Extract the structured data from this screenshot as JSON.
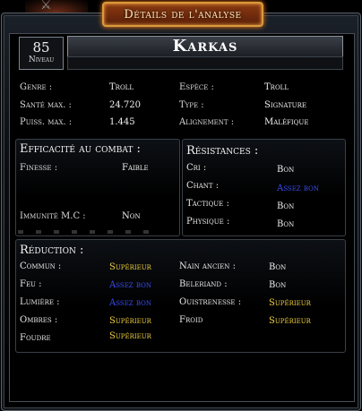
{
  "window": {
    "title": "Détails de l'analyse"
  },
  "header": {
    "level_value": "85",
    "level_label": "Niveau",
    "creature_name": "Karkas"
  },
  "stats": {
    "genre_label": "Genre :",
    "genre_value": "Troll",
    "sante_label": "Santé max. :",
    "sante_value": "24.720",
    "puiss_label": "Puiss. max. :",
    "puiss_value": "1.445",
    "espece_label": "Espèce :",
    "espece_value": "Troll",
    "type_label": "Type :",
    "type_value": "Signature",
    "align_label": "Alignement :",
    "align_value": "Maléfique"
  },
  "combat": {
    "title": "Efficacité au combat :",
    "finesse_label": "Finesse :",
    "finesse_value": "Faible",
    "immunite_label": "Immunité M.C :",
    "immunite_value": "Non"
  },
  "resistances": {
    "title": "Résistances :",
    "rows": [
      {
        "label": "Cri :",
        "value": "Bon"
      },
      {
        "label": "Chant :",
        "value": "Assez bon"
      },
      {
        "label": "Tactique :",
        "value": "Bon"
      },
      {
        "label": "Physique :",
        "value": "Bon"
      }
    ]
  },
  "reduction": {
    "title": "Réduction :",
    "left": [
      {
        "label": "Commun :",
        "value": "Supérieur"
      },
      {
        "label": "Feu :",
        "value": "Assez bon"
      },
      {
        "label": "Lumière :",
        "value": "Assez bon"
      },
      {
        "label": "Ombres :",
        "value": "Supérieur"
      },
      {
        "label": "Foudre",
        "value": "Supérieur"
      }
    ],
    "right": [
      {
        "label": "Nain ancien :",
        "value": "Bon"
      },
      {
        "label": "Beleriand :",
        "value": "Bon"
      },
      {
        "label": "Ouistrenesse :",
        "value": "Supérieur"
      },
      {
        "label": "Froid",
        "value": "Supérieur"
      }
    ]
  },
  "colors": {
    "accent_title": "#d99a3a",
    "value_blue": "#3a4df0",
    "value_yellow": "#f0d040"
  },
  "icons": {
    "top_ornament": "sword-icon"
  }
}
